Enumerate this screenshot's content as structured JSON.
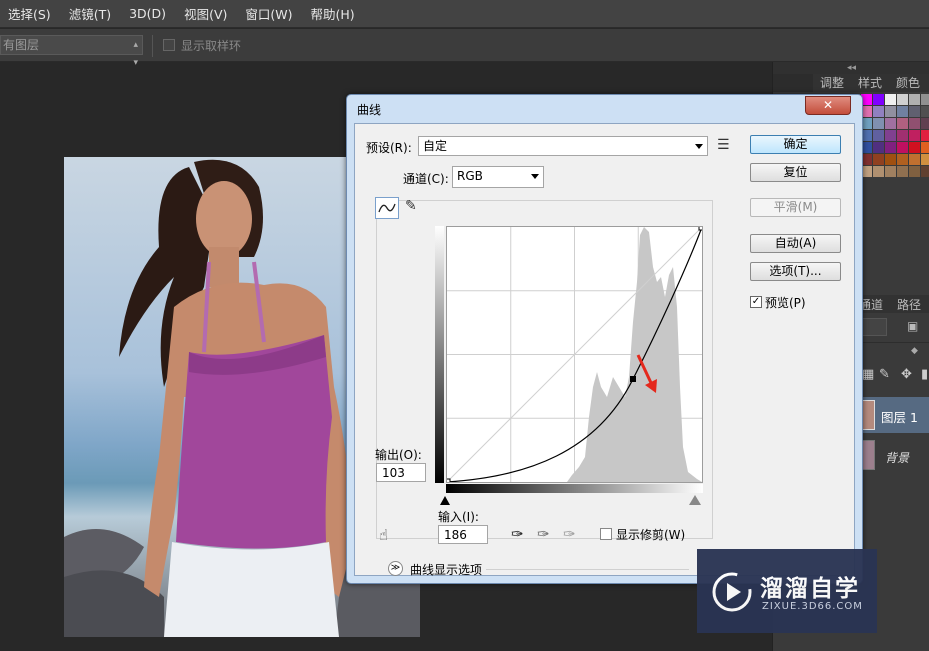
{
  "menu": [
    "选择(S)",
    "滤镜(T)",
    "3D(D)",
    "视图(V)",
    "窗口(W)",
    "帮助(H)"
  ],
  "options_bar": {
    "layer_select": "有图层",
    "sample_ring_label": "显示取样环"
  },
  "right_panel": {
    "collapse_glyph": "◂◂",
    "tabs": [
      "调整",
      "样式",
      "颜色"
    ],
    "layer_tabs": [
      "通道",
      "路径"
    ],
    "layers": [
      "图层 1",
      "背景"
    ]
  },
  "dialog": {
    "title": "曲线",
    "close_glyph": "✕",
    "preset_label": "预设(R):",
    "preset_value": "自定",
    "channel_label": "通道(C):",
    "channel_value": "RGB",
    "output_label": "输出(O):",
    "output_value": "103",
    "input_label": "输入(I):",
    "input_value": "186",
    "show_clipping_label": "显示修剪(W)",
    "curve_options_label": "曲线显示选项",
    "buttons": {
      "ok": "确定",
      "reset": "复位",
      "smooth": "平滑(M)",
      "auto": "自动(A)",
      "options": "选项(T)..."
    },
    "preview_label": "预览(P)",
    "preview_checked": true
  },
  "watermark": {
    "brand": "溜溜自学",
    "url": "ZIXUE.3D66.COM"
  },
  "colors": {
    "accent_red": "#e4281c",
    "dialog_frame": "#cde0f4",
    "ok_button": "#bee6fd"
  }
}
